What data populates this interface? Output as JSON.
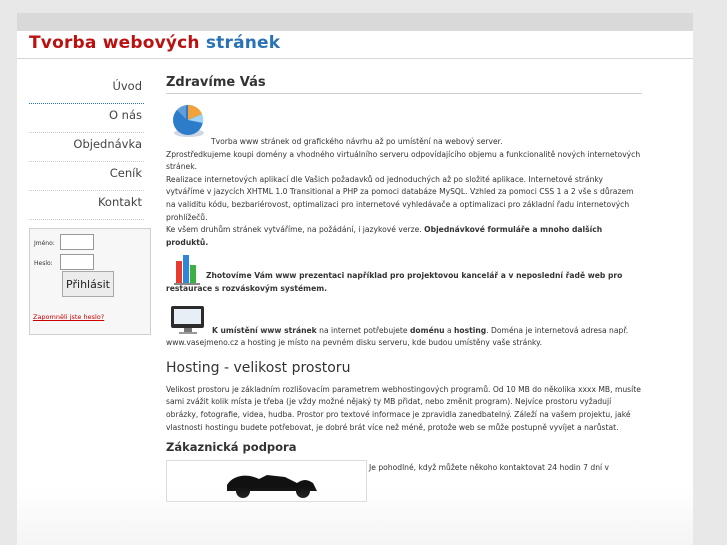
{
  "site": {
    "title_part1": "Tvorba webových",
    "title_part2": "stránek"
  },
  "nav": {
    "items": [
      "Úvod",
      "O nás",
      "Objednávka",
      "Ceník",
      "Kontakt"
    ]
  },
  "login": {
    "username_label": "Jméno:",
    "password_label": "Heslo:",
    "username_value": "",
    "password_value": "",
    "submit_label": "Přihlásit",
    "forgot_link": "Zapomněli jste heslo?"
  },
  "main": {
    "welcome_heading": "Zdravíme Vás",
    "intro_line": "Tvorba www stránek od grafického návrhu až po umístění na webový server.",
    "domains_text": "Zprostředkujeme koupi domény a vhodného virtuálního serveru odpovídajícího objemu a funkcionalitě nových internetových stránek.",
    "apps_text": "Realizace internetových aplikací dle Vašich požadavků od jednoduchých až po složité aplikace. Internetové stránky vytváříme v jazycích XHTML 1.0 Transitional a PHP za pomoci databáze MySQL. Vzhled za pomoci CSS 1 a 2 vše s důrazem na validitu kódu, bezbariérovost, optimalizaci pro internetové vyhledávače a optimalizaci pro základní řadu internetových prohlížečů.",
    "lang_text": "Ke všem druhům stránek vytváříme, na požádání, i jazykové verze.",
    "lang_bold": "Objednávkové formuláře a mnoho dalších produktů.",
    "presentation_bold": "Zhotovíme Vám www prezentaci například pro projektovou kancelář a v neposlední řadě web pro restaurace s rozváskovým systémem.",
    "hosting_lead_bold": "K umístění www stránek",
    "hosting_lead_mid": " na internet potřebujete ",
    "hosting_lead_b2": "doménu",
    "hosting_lead_and": " a ",
    "hosting_lead_b3": "hosting",
    "hosting_lead_rest": ". Doména je internetová adresa např. www.vasejmeno.cz a hosting je místo na pevném disku serveru, kde budou umístěny vaše stránky.",
    "hosting_heading": "Hosting - velikost prostoru",
    "hosting_text": "Velikost prostoru je základním rozlišovacím parametrem webhostingových programů. Od 10 MB do několika xxxx MB, musíte sami zvážit kolik místa je třeba (je vždy možné nějaký ty MB přidat, nebo změnit program). Nejvíce prostoru vyžadují obrázky, fotografie, videa, hudba. Prostor pro textové informace je zpravidla zanedbatelný. Záleží na vašem projektu, jaké vlastnosti hostingu budete potřebovat, je dobré brát více než méně, protože web se může postupně vyvíjet a narůstat.",
    "support_heading": "Zákaznická podpora",
    "support_text": "Je pohodlné, když můžete někoho kontaktovat 24 hodin 7 dní v"
  },
  "icons": [
    "pie-chart-icon",
    "bar-chart-icon",
    "monitor-icon",
    "motorcycle-image"
  ]
}
